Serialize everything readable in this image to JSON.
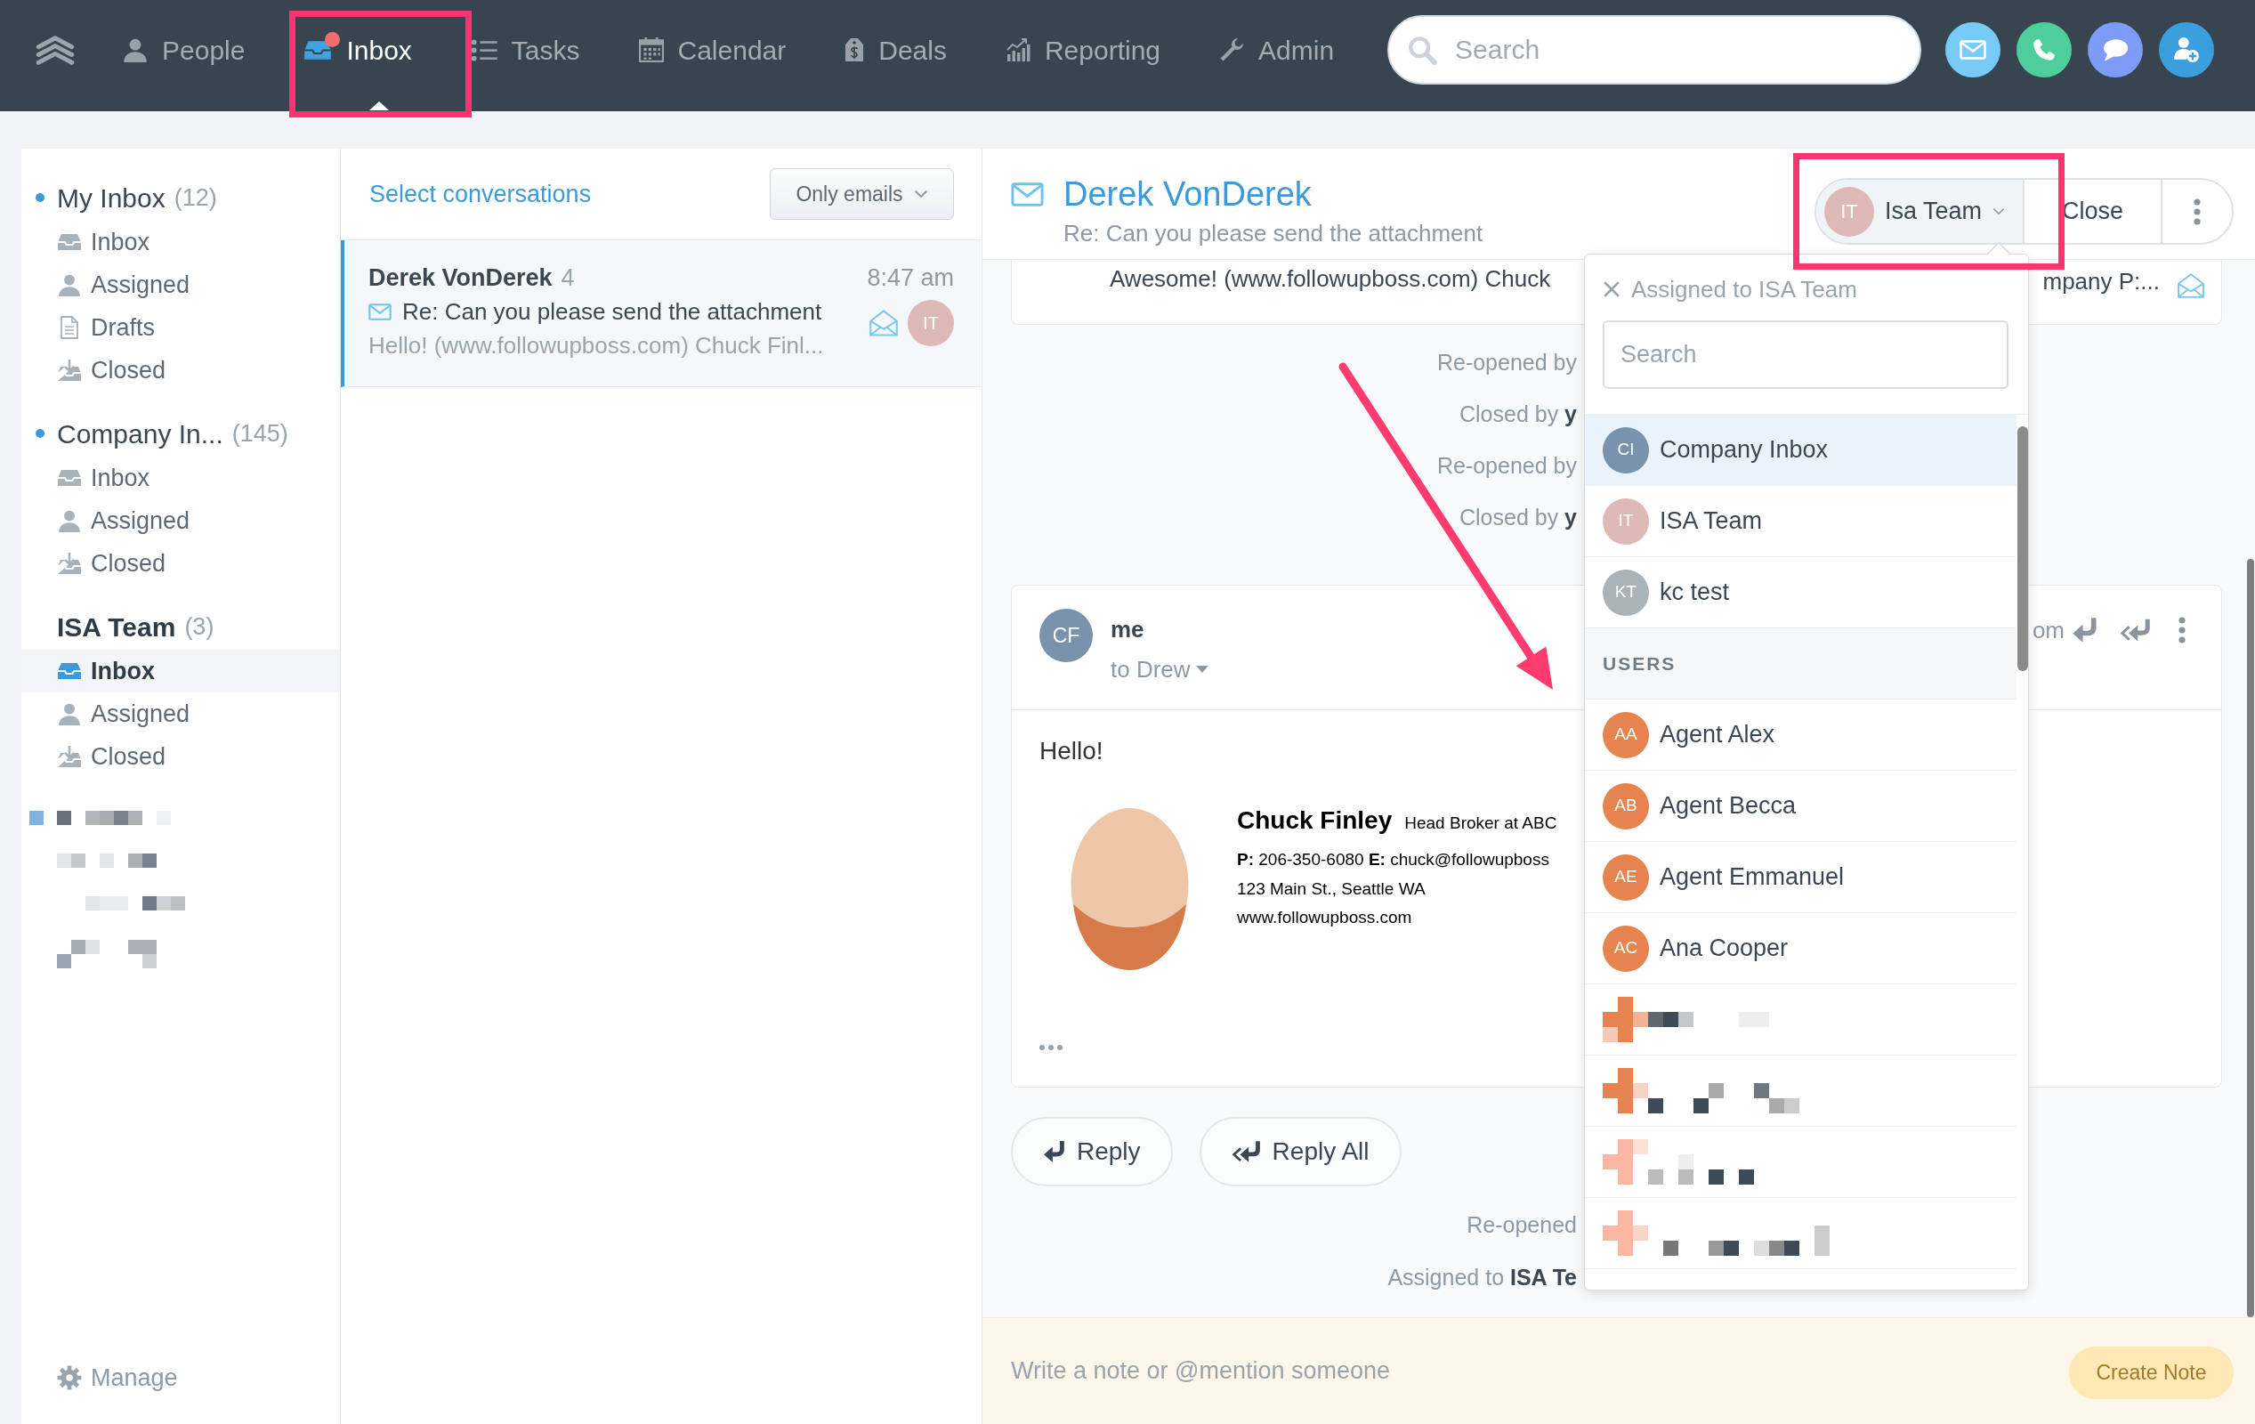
{
  "top_nav": {
    "items": [
      {
        "kind": "person",
        "label": "People",
        "selected": false,
        "unread": false
      },
      {
        "kind": "inbox",
        "label": "Inbox",
        "selected": true,
        "unread": true
      },
      {
        "kind": "list",
        "label": "Tasks",
        "selected": false,
        "unread": false
      },
      {
        "kind": "calendar",
        "label": "Calendar",
        "selected": false,
        "unread": false
      },
      {
        "kind": "tag",
        "label": "Deals",
        "selected": false,
        "unread": false
      },
      {
        "kind": "chart",
        "label": "Reporting",
        "selected": false,
        "unread": false
      },
      {
        "kind": "wrench",
        "label": "Admin",
        "selected": false,
        "unread": false
      }
    ],
    "search": {
      "placeholder": "Search"
    },
    "quick_actions": [
      {
        "kind": "email",
        "color": "#79cbf7"
      },
      {
        "kind": "phone",
        "color": "#4dce9b"
      },
      {
        "kind": "message",
        "color": "#7e9cf7"
      },
      {
        "kind": "add-person",
        "color": "#3a9fdc"
      }
    ]
  },
  "sidebar": {
    "groups": [
      {
        "title": "My Inbox",
        "count": "(12)",
        "unread": true,
        "active": false,
        "items": [
          {
            "kind": "inbox",
            "label": "Inbox",
            "selected": false
          },
          {
            "kind": "assigned",
            "label": "Assigned",
            "selected": false
          },
          {
            "kind": "drafts",
            "label": "Drafts",
            "selected": false
          },
          {
            "kind": "closed",
            "label": "Closed",
            "selected": false
          }
        ]
      },
      {
        "title": "Company In...",
        "count": "(145)",
        "unread": true,
        "active": false,
        "items": [
          {
            "kind": "inbox",
            "label": "Inbox",
            "selected": false
          },
          {
            "kind": "assigned",
            "label": "Assigned",
            "selected": false
          },
          {
            "kind": "closed",
            "label": "Closed",
            "selected": false
          }
        ]
      },
      {
        "title": "ISA Team",
        "count": "(3)",
        "unread": false,
        "active": true,
        "items": [
          {
            "kind": "inbox",
            "label": "Inbox",
            "selected": true
          },
          {
            "kind": "assigned",
            "label": "Assigned",
            "selected": false
          },
          {
            "kind": "closed",
            "label": "Closed",
            "selected": false
          }
        ]
      }
    ],
    "manage": "Manage"
  },
  "conversation_list": {
    "select_link": "Select conversations",
    "filter": {
      "label": "Only emails"
    },
    "conversations": [
      {
        "name": "Derek VonDerek",
        "count": "4",
        "time": "8:47 am",
        "subject": "Re: Can you please send the attachment",
        "preview": "Hello! (www.followupboss.com) Chuck Finl...",
        "assignee_initials": "IT",
        "selected": true
      }
    ]
  },
  "conversation": {
    "title": "Derek VonDerek",
    "subject": "Re: Can you please send the attachment",
    "assign_button": {
      "initials": "IT",
      "label": "Isa Team",
      "expanded": true
    },
    "close_button": "Close",
    "previous_message": {
      "preview": "Awesome! (www.followupboss.com) Chuck",
      "preview_end": "mpany P:..."
    },
    "events": [
      {
        "text": "Re-opened by"
      },
      {
        "text": "Closed by **y**"
      },
      {
        "text": "Re-opened by"
      },
      {
        "text": "Closed by **y**"
      }
    ],
    "message": {
      "initials": "CF",
      "sender": "me",
      "recipient": "to Drew",
      "meta": "om",
      "body": "Hello!",
      "signature": {
        "name": "Chuck Finley",
        "title": "Head Broker at ABC",
        "contact": "**P:** 206-350-6080 **E:** chuck@followupboss",
        "address": "123 Main St., Seattle WA",
        "website": "www.followupboss.com"
      }
    },
    "reply_buttons": [
      {
        "kind": "reply",
        "label": "Reply"
      },
      {
        "kind": "reply-all",
        "label": "Reply All"
      }
    ],
    "events_after": [
      {
        "text": "Re-opened"
      },
      {
        "text": "Assigned to **ISA Te**"
      }
    ],
    "note": {
      "placeholder": "Write a note or @mention someone",
      "button": "Create Note",
      "disabled": true
    }
  },
  "assign_dropdown": {
    "header": "Assigned to ISA Team",
    "search": {
      "placeholder": "Search"
    },
    "teams": [
      {
        "kind": "entry",
        "initials": "CI",
        "name": "Company Inbox",
        "color": "#7a93ad",
        "selected": true
      },
      {
        "kind": "entry",
        "initials": "IT",
        "name": "ISA Team",
        "color": "#deb9b6",
        "selected": false
      },
      {
        "kind": "entry",
        "initials": "KT",
        "name": "kc test",
        "color": "#a9b3b8",
        "selected": false
      }
    ],
    "users_heading": "USERS",
    "users": [
      {
        "kind": "entry",
        "initials": "AA",
        "name": "Agent Alex",
        "color": "#e6834e",
        "selected": false
      },
      {
        "kind": "entry",
        "initials": "AB",
        "name": "Agent Becca",
        "color": "#e6834e",
        "selected": false
      },
      {
        "kind": "entry",
        "initials": "AE",
        "name": "Agent Emmanuel",
        "color": "#e6834e",
        "selected": false
      },
      {
        "kind": "entry",
        "initials": "AC",
        "name": "Ana Cooper",
        "color": "#e6834e",
        "selected": false
      },
      {
        "kind": "redacted",
        "selected": false
      },
      {
        "kind": "redacted",
        "selected": false
      },
      {
        "kind": "redacted",
        "selected": false
      },
      {
        "kind": "redacted",
        "selected": false
      }
    ]
  }
}
